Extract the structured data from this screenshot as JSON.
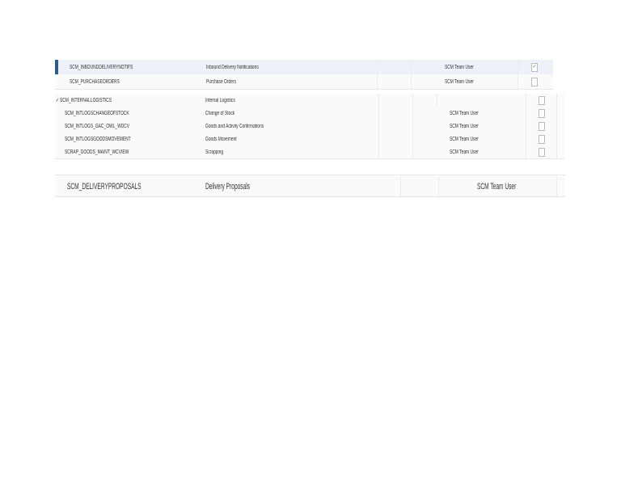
{
  "panel1": {
    "rows": [
      {
        "name": "SCM_INBOUNDDELIVERYNOTIFS",
        "description": "Inbound Delivery Notifications",
        "role": "SCM Team User",
        "checked": true,
        "selected": true
      },
      {
        "name": "SCM_PURCHASEORDERS",
        "description": "Purchase Orders",
        "role": "SCM Team User",
        "checked": false
      }
    ]
  },
  "panel2": {
    "group": {
      "expand_icon": "check-chevron",
      "name": "SCM_INTERNALLOGISTICS",
      "description": "Internal Logistics",
      "expand_glyph": "✓"
    },
    "rows": [
      {
        "name": "SCM_INTLOGSCHANGEOFSTOCK",
        "description": "Change of Stock",
        "role": "SCM Team User"
      },
      {
        "name": "SCM_INTLOGS_GAC_OWL_WDCV",
        "description": "Goods and Activity Confirmations",
        "role": "SCM Team User"
      },
      {
        "name": "SCM_INTLOGSGOODSMOVEMENT",
        "description": "Goods Movement",
        "role": "SCM Team User"
      },
      {
        "name": "SCRAP_GOODS_MAINT_WCVIEW",
        "description": "Scrapping",
        "role": "SCM Team User"
      }
    ]
  },
  "panel3": {
    "rows": [
      {
        "name": "SCM_DELIVERYPROPOSALS",
        "description": "Delivery Proposals",
        "role": "SCM Team User"
      }
    ]
  },
  "check_glyph": "✓"
}
